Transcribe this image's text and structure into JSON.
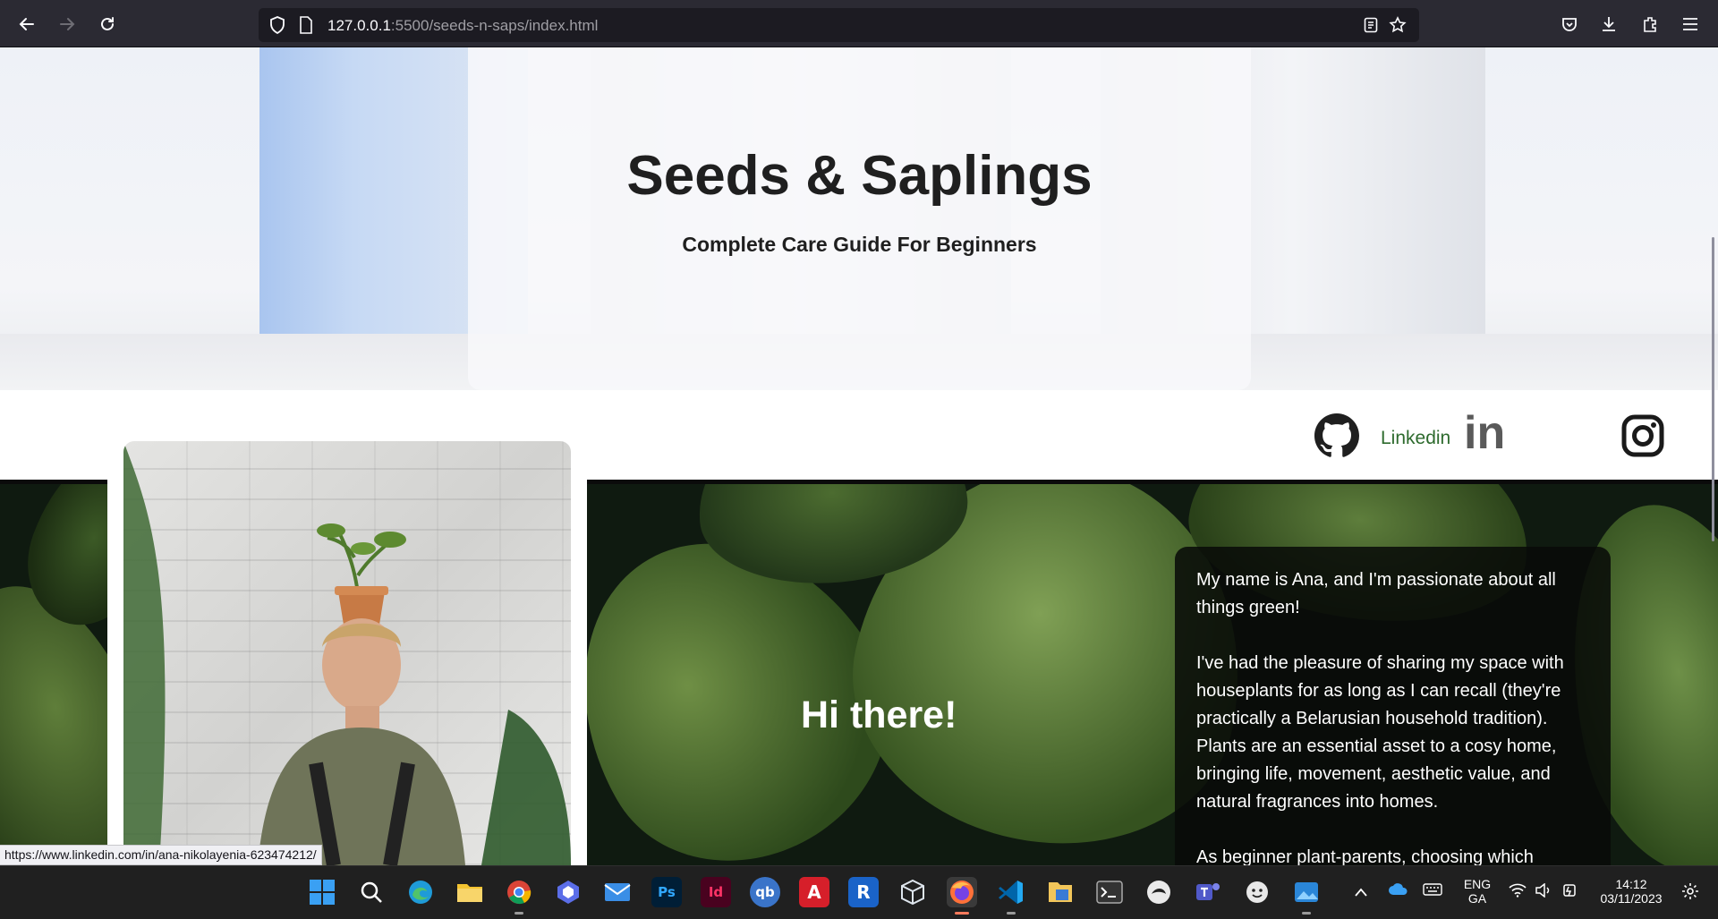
{
  "browser": {
    "url_host": "127.0.0.1",
    "url_path": ":5500/seeds-n-saps/index.html",
    "status_link": "https://www.linkedin.com/in/ana-nikolayenia-623474212/"
  },
  "hero": {
    "title": "Seeds & Saplings",
    "subtitle": "Complete Care Guide For Beginners"
  },
  "social": {
    "linkedin_label": "Linkedin",
    "linkedin_glyph": "in"
  },
  "intro": {
    "greeting": "Hi there!",
    "paragraphs": [
      "My name is Ana, and I'm passionate about all things green!",
      "I've had the pleasure of sharing my space with houseplants for as long as I can recall (they're practically a Belarusian household tradition). Plants are an essential asset to a cosy home, bringing life, movement, aesthetic value, and natural fragrances into homes.",
      "As beginner plant-parents, choosing which"
    ]
  },
  "taskbar": {
    "ps_label": "Ps",
    "id_label": "Id",
    "qb_label": "qb",
    "cad_label": "A",
    "rvt_label": "R",
    "lang_primary": "ENG",
    "lang_secondary": "GA",
    "time": "14:12",
    "date": "03/11/2023"
  },
  "colors": {
    "linkedin_text": "#2e6b2e",
    "chrome_bg": "#2b2a33",
    "taskbar_bg": "#202020"
  }
}
